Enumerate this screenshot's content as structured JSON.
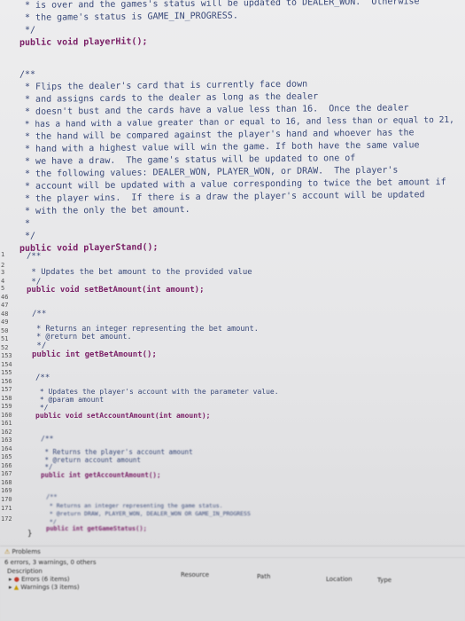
{
  "top_code": {
    "l1": " * is over and the games's status will be updated to DEALER_WON.  Otherwise",
    "l2": " * the game's status is GAME_IN_PROGRESS.",
    "l3": " */",
    "l4": "public void playerHit();",
    "l5": "/**",
    "l6": " * Flips the dealer's card that is currently face down",
    "l7": " * and assigns cards to the dealer as long as the dealer",
    "l8": " * doesn't bust and the cards have a value less than 16.  Once the dealer",
    "l9": " * has a hand with a value greater than or equal to 16, and less than or equal to 21,",
    "l10": " * the hand will be compared against the player's hand and whoever has the",
    "l11": " * hand with a highest value will win the game. If both have the same value",
    "l12": " * we have a draw.  The game's status will be updated to one of",
    "l13": " * the following values: DEALER_WON, PLAYER_WON, or DRAW.  The player's",
    "l14": " * account will be updated with a value corresponding to twice the bet amount if",
    "l15": " * the player wins.  If there is a draw the player's account will be updated",
    "l16": " * with the only the bet amount.",
    "l17": " *",
    "l18": " */",
    "l19": "public void playerStand();"
  },
  "gutter": {
    "g1": "1",
    "g2": "2",
    "g3": "3",
    "g4": "4",
    "g5": "5",
    "g6": "46",
    "g7": "47",
    "g8": "48",
    "g9": "49",
    "g10": "50",
    "g11": "51",
    "g12": "52",
    "g13": "153",
    "g14": "154",
    "g15": "155",
    "g16": "156",
    "g17": "157",
    "g18": "158",
    "g19": "159",
    "g20": "160",
    "g21": "161",
    "g22": "162",
    "g23": "163",
    "g24": "164",
    "g25": "165",
    "g26": "166",
    "g27": "167",
    "g28": "168",
    "g29": "169",
    "g30": "170",
    "g31": "171",
    "g32": "172"
  },
  "bottom_code": {
    "c1": "/**",
    "c2": " * Updates the bet amount to the provided value",
    "c3": " */",
    "c4": "public void setBetAmount(int amount);",
    "c5": "/**",
    "c6": " * Returns an integer representing the bet amount.",
    "c7": " * @return bet amount.",
    "c8": " */",
    "c9": "public int getBetAmount();",
    "c10": "/**",
    "c11": " * Updates the player's account with the parameter value.",
    "c12": " * @param amount",
    "c13": " */",
    "c14": "public void setAccountAmount(int amount);",
    "c15": "/**",
    "c16": " * Returns the player's account amount",
    "c17": " * @return account amount",
    "c18": " */",
    "c19": "public int getAccountAmount();",
    "c20": "/**",
    "c21": " * Returns an integer representing the game status.",
    "c22": " * @return DRAW, PLAYER_WON, DEALER_WON OR GAME_IN_PROGRESS",
    "c23": " */",
    "c24": "public int getGameStatus();",
    "c25": "}"
  },
  "problems_panel": {
    "tab_label": "Problems",
    "summary": "6 errors, 3 warnings, 0 others",
    "col_description": "Description",
    "col_resource": "Resource",
    "col_path": "Path",
    "col_location": "Location",
    "col_type": "Type",
    "errors_group": "Errors (6 items)",
    "warnings_group": "Warnings (3 items)"
  }
}
